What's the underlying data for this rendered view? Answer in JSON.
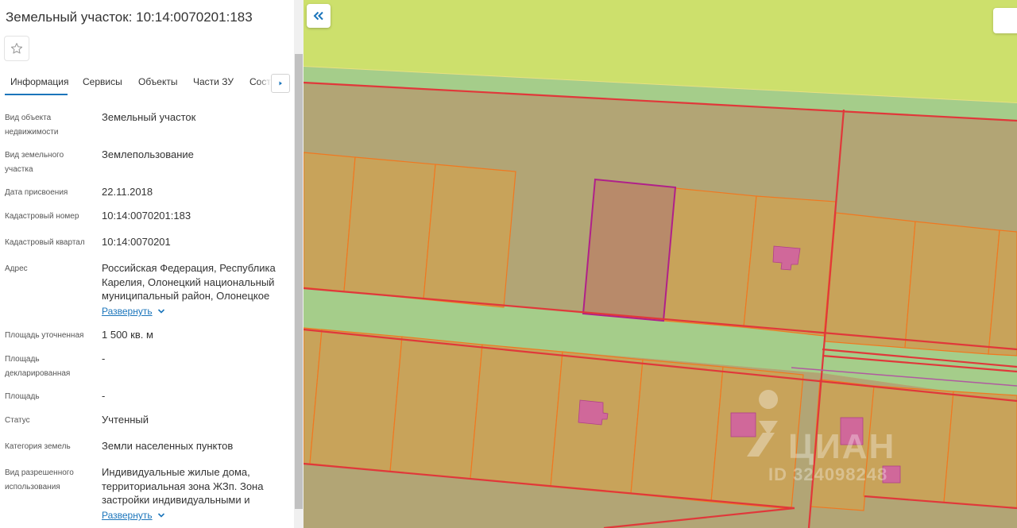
{
  "panel": {
    "title": "Земельный участок: 10:14:0070201:183",
    "tabs": [
      {
        "label": "Информация"
      },
      {
        "label": "Сервисы"
      },
      {
        "label": "Объекты"
      },
      {
        "label": "Части ЗУ"
      },
      {
        "label": "Соста"
      }
    ],
    "rows": [
      {
        "label": "Вид объекта недвижимости",
        "value": "Земельный участок"
      },
      {
        "label": "Вид земельного участка",
        "value": "Землепользование"
      },
      {
        "label": "Дата присвоения",
        "value": "22.11.2018"
      },
      {
        "label": "Кадастровый номер",
        "value": "10:14:0070201:183"
      },
      {
        "label": "Кадастровый квартал",
        "value": "10:14:0070201"
      },
      {
        "label": "Адрес",
        "value": "Российская Федерация, Республика Карелия, Олонецкий национальный муниципальный район, Олонецкое"
      },
      {
        "label": "Площадь уточненная",
        "value": "1 500 кв. м"
      },
      {
        "label": "Площадь декларированная",
        "value": "-"
      },
      {
        "label": "Площадь",
        "value": "-"
      },
      {
        "label": "Статус",
        "value": "Учтенный"
      },
      {
        "label": "Категория земель",
        "value": "Земли населенных пунктов"
      },
      {
        "label": "Вид разрешенного использования",
        "value": "Индивидуальные жилые дома, территориальная зона ЖЗп. Зона застройки индивидуальными и"
      }
    ],
    "expand_label": "Развернуть"
  },
  "map": {
    "collapse_icon": "double-chevron-left-icon",
    "watermark_brand": "ЦИАН",
    "watermark_id": "ID 324098248"
  },
  "colors": {
    "accent": "#1b75bb",
    "parcel_fill": "#c8a35a",
    "parcel_border": "#f07820",
    "boundary": "#e0383a",
    "selected_parcel": "#b8426e",
    "green_strip": "#a5cd8a",
    "field": "#cde06c",
    "building": "#d0689a"
  }
}
